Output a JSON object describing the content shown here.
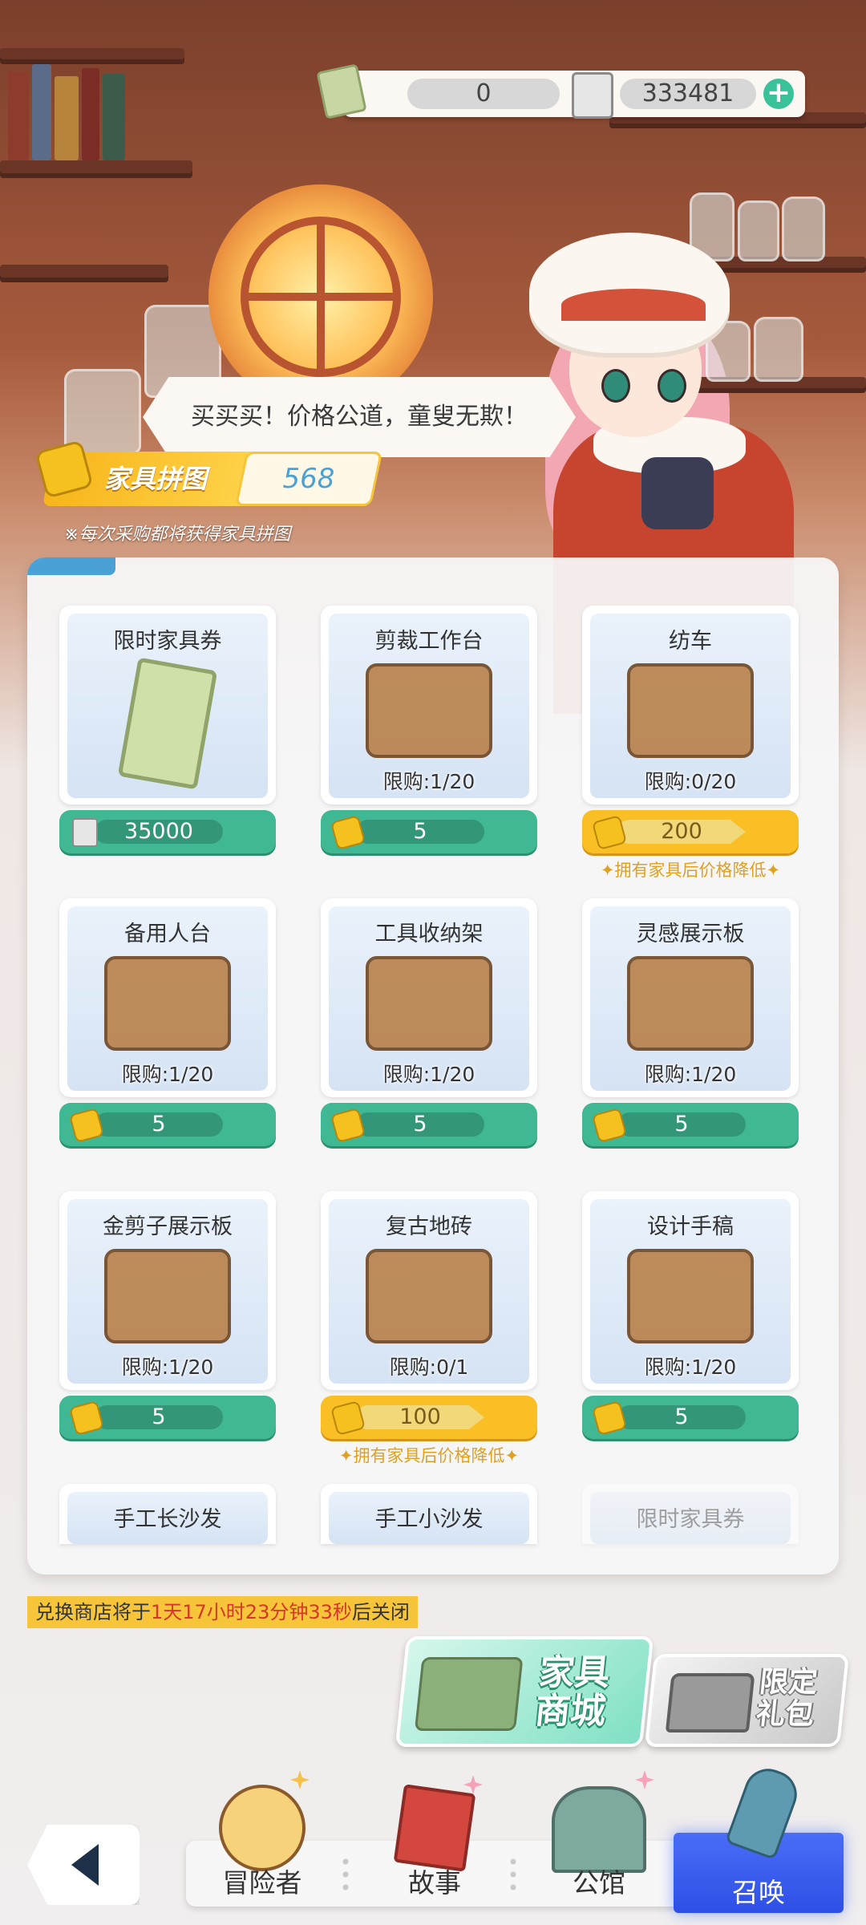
{
  "currency": {
    "tickets": "0",
    "coins": "333481",
    "ticket_icon": "furniture-ticket-icon",
    "coin_icon": "coin-card-icon",
    "add_icon": "plus-icon"
  },
  "dialog": {
    "text": "买买买！价格公道，童叟无欺！"
  },
  "puzzle": {
    "label": "家具拼图",
    "count": "568",
    "note": "※每次采购都将获得家具拼图"
  },
  "items": [
    {
      "name": "限时家具券",
      "limit": "",
      "price": "35000",
      "currency": "coin",
      "style": "green",
      "discount": ""
    },
    {
      "name": "剪裁工作台",
      "limit": "限购:1/20",
      "price": "5",
      "currency": "puzzle",
      "style": "green",
      "discount": ""
    },
    {
      "name": "纺车",
      "limit": "限购:0/20",
      "price": "200",
      "currency": "puzzle",
      "style": "gold",
      "discount": "✦拥有家具后价格降低✦"
    },
    {
      "name": "备用人台",
      "limit": "限购:1/20",
      "price": "5",
      "currency": "puzzle",
      "style": "green",
      "discount": ""
    },
    {
      "name": "工具收纳架",
      "limit": "限购:1/20",
      "price": "5",
      "currency": "puzzle",
      "style": "green",
      "discount": ""
    },
    {
      "name": "灵感展示板",
      "limit": "限购:1/20",
      "price": "5",
      "currency": "puzzle",
      "style": "green",
      "discount": ""
    },
    {
      "name": "金剪子展示板",
      "limit": "限购:1/20",
      "price": "5",
      "currency": "puzzle",
      "style": "green",
      "discount": ""
    },
    {
      "name": "复古地砖",
      "limit": "限购:0/1",
      "price": "100",
      "currency": "puzzle",
      "style": "gold",
      "discount": "✦拥有家具后价格降低✦"
    },
    {
      "name": "设计手稿",
      "limit": "限购:1/20",
      "price": "5",
      "currency": "puzzle",
      "style": "green",
      "discount": ""
    },
    {
      "name": "手工长沙发",
      "limit": "",
      "price": "",
      "currency": "puzzle",
      "style": "green",
      "discount": ""
    },
    {
      "name": "手工小沙发",
      "limit": "",
      "price": "",
      "currency": "puzzle",
      "style": "green",
      "discount": ""
    },
    {
      "name": "限时家具券",
      "limit": "",
      "price": "",
      "currency": "coin",
      "style": "green",
      "discount": ""
    }
  ],
  "timer": {
    "prefix": "兑换商店将于",
    "highlight": "1天17小时23分钟33秒",
    "suffix": "后关闭"
  },
  "promos": {
    "furniture_shop": "家具商城",
    "limited_gift": "限定礼包"
  },
  "nav": {
    "adventurer": "冒险者",
    "story": "故事",
    "guild": "公馆",
    "summon": "召唤"
  },
  "colors": {
    "green_price": "#3fb893",
    "gold_price": "#f9bf25",
    "summon_blue": "#2d4fe6",
    "timer_bg": "#f7c53a"
  }
}
